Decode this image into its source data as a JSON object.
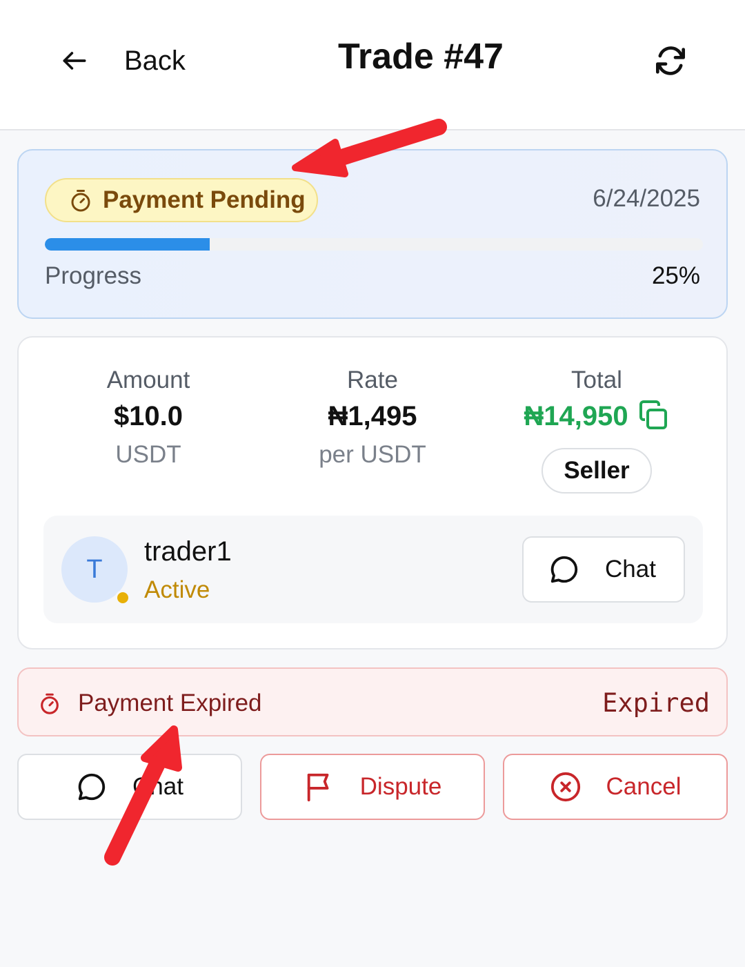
{
  "header": {
    "back_label": "Back",
    "title": "Trade #47"
  },
  "status": {
    "badge": "Payment Pending",
    "date": "6/24/2025",
    "progress_label": "Progress",
    "progress_text": "25%",
    "progress_fraction": 0.25
  },
  "details": {
    "amount": {
      "label": "Amount",
      "value": "$10.0",
      "sub": "USDT"
    },
    "rate": {
      "label": "Rate",
      "value": "₦1,495",
      "sub": "per USDT"
    },
    "total": {
      "label": "Total",
      "value": "₦14,950",
      "badge": "Seller"
    }
  },
  "trader": {
    "initial": "T",
    "name": "trader1",
    "status": "Active",
    "chat_label": "Chat"
  },
  "expired": {
    "title": "Payment Expired",
    "tag": "Expired"
  },
  "actions": {
    "chat_label": "Chat",
    "dispute_label": "Dispute",
    "cancel_label": "Cancel"
  },
  "colors": {
    "accent_blue": "#2b8ee8",
    "total_green": "#1fa653",
    "pending_text": "#7a4a0c",
    "danger_red": "#c8262a",
    "annotation_red": "#f0262e"
  }
}
